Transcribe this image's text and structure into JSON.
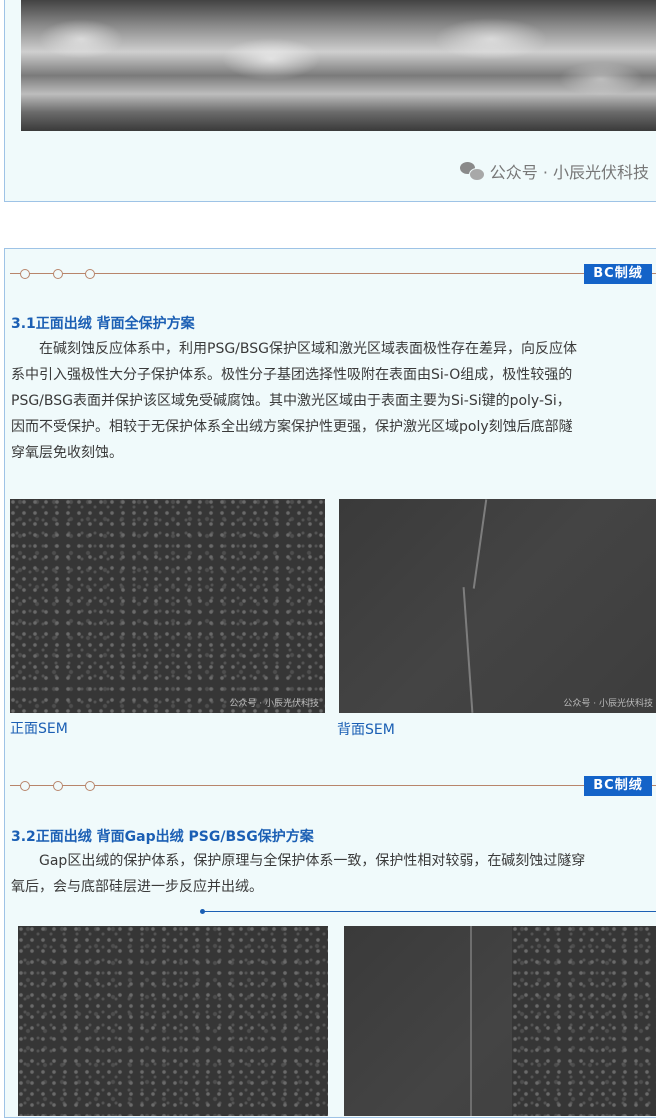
{
  "watermark": {
    "text": "公众号 · 小辰光伏科技"
  },
  "sections": [
    {
      "tag": "BC制绒",
      "heading": "3.1正面出绒 背面全保护方案",
      "paragraph_lines": [
        "　　在碱刻蚀反应体系中，利用PSG/BSG保护区域和激光区域表面极性存在差异，向反应体",
        "系中引入强极性大分子保护体系。极性分子基团选择性吸附在表面由Si-O组成，极性较强的",
        "PSG/BSG表面并保护该区域免受碱腐蚀。其中激光区域由于表面主要为Si-Si键的poly-Si，",
        "因而不受保护。相较于无保护体系全出绒方案保护性更强，保护激光区域poly刻蚀后底部隧",
        "穿氧层免收刻蚀。"
      ],
      "captions": [
        "正面SEM",
        "背面SEM"
      ]
    },
    {
      "tag": "BC制绒",
      "heading": "3.2正面出绒 背面Gap出绒 PSG/BSG保护方案",
      "paragraph_lines": [
        "　　Gap区出绒的保护体系，保护原理与全保护体系一致，保护性相对较弱，在碱刻蚀过隧穿",
        "氧后，会与底部硅层进一步反应并出绒。"
      ]
    }
  ],
  "icons": {
    "watermark": "wechat-icon"
  },
  "colors": {
    "accent": "#1463c8",
    "heading": "#1b5fb4",
    "divider": "#b8856b",
    "card_bg": "#f0fafb"
  }
}
